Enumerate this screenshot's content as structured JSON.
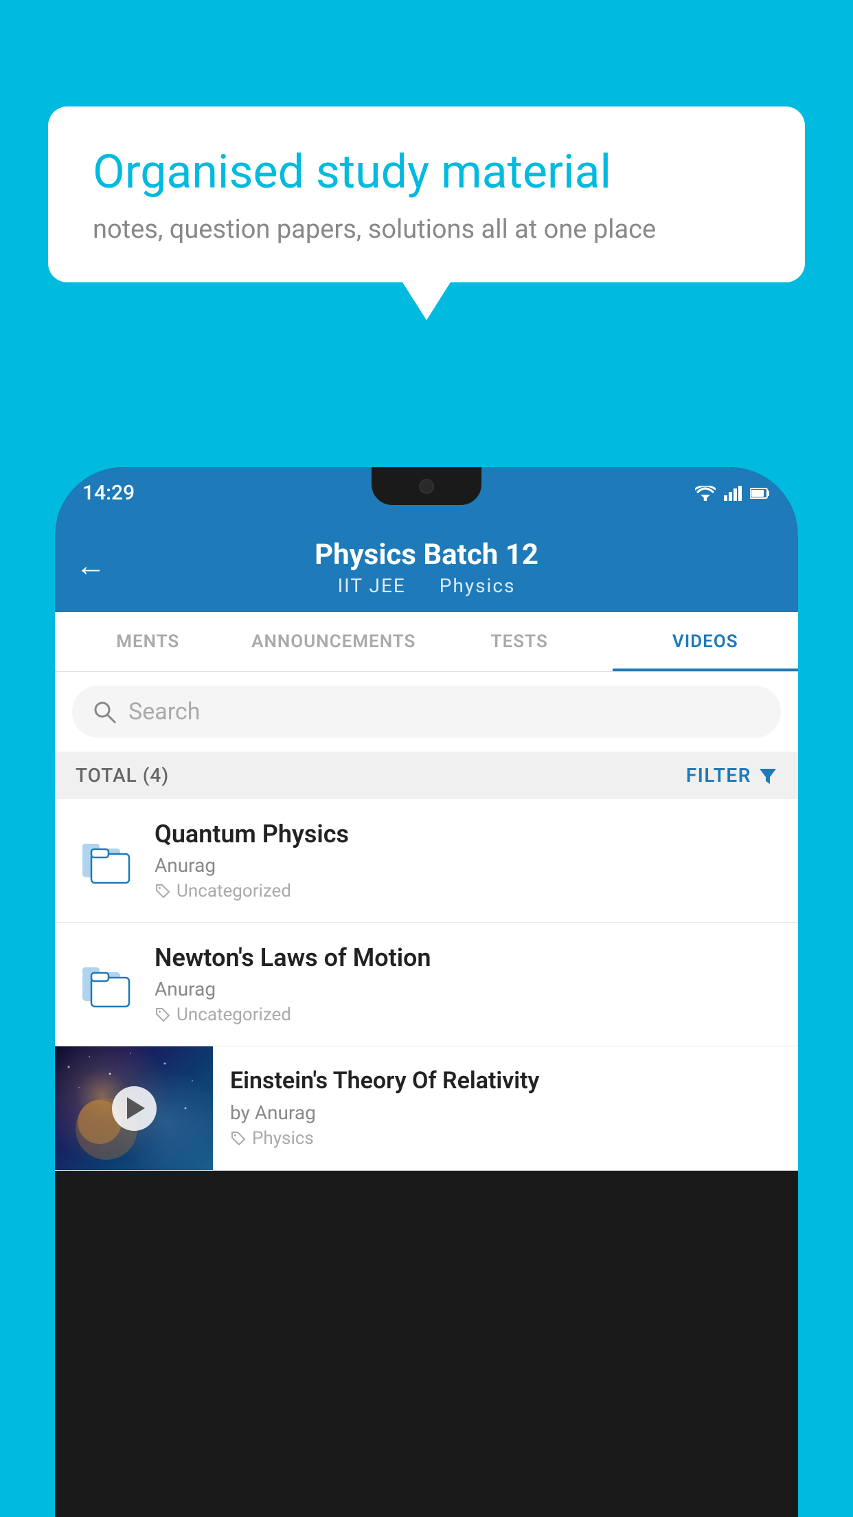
{
  "background": {
    "color": "#00BADF"
  },
  "speech_bubble": {
    "title": "Organised study material",
    "subtitle": "notes, question papers, solutions all at one place"
  },
  "phone": {
    "status_bar": {
      "time": "14:29",
      "wifi_icon": "wifi",
      "signal_icon": "signal",
      "battery_icon": "battery"
    },
    "header": {
      "back_label": "←",
      "title": "Physics Batch 12",
      "subtitle_left": "IIT JEE",
      "subtitle_right": "Physics"
    },
    "tabs": [
      {
        "label": "MENTS",
        "active": false
      },
      {
        "label": "ANNOUNCEMENTS",
        "active": false
      },
      {
        "label": "TESTS",
        "active": false
      },
      {
        "label": "VIDEOS",
        "active": true
      }
    ],
    "search": {
      "placeholder": "Search"
    },
    "filter_bar": {
      "total_label": "TOTAL (4)",
      "filter_label": "FILTER"
    },
    "video_items": [
      {
        "id": 1,
        "title": "Quantum Physics",
        "author": "Anurag",
        "tag": "Uncategorized",
        "has_thumbnail": false
      },
      {
        "id": 2,
        "title": "Newton's Laws of Motion",
        "author": "Anurag",
        "tag": "Uncategorized",
        "has_thumbnail": false
      },
      {
        "id": 3,
        "title": "Einstein's Theory Of Relativity",
        "author": "by Anurag",
        "tag": "Physics",
        "has_thumbnail": true
      }
    ]
  }
}
